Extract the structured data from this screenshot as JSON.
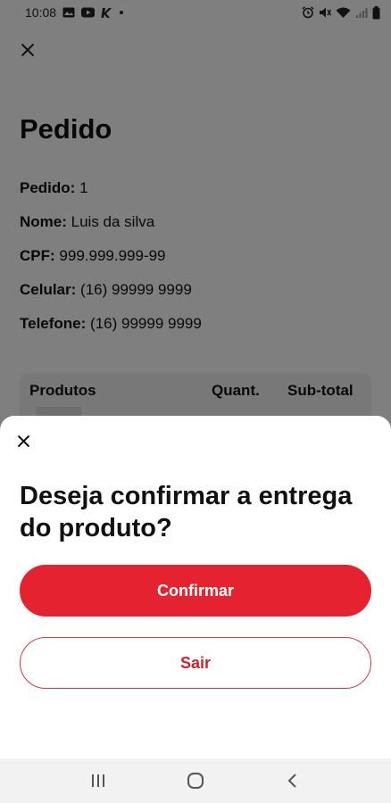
{
  "status_bar": {
    "time": "10:08"
  },
  "page": {
    "title": "Pedido",
    "fields": [
      {
        "label": "Pedido:",
        "value": "1"
      },
      {
        "label": "Nome:",
        "value": "Luis da silva"
      },
      {
        "label": "CPF:",
        "value": "999.999.999-99"
      },
      {
        "label": "Celular:",
        "value": "(16) 99999 9999"
      },
      {
        "label": "Telefone:",
        "value": "(16) 99999 9999"
      }
    ],
    "table_headers": {
      "produtos": "Produtos",
      "quant": "Quant.",
      "subtotal": "Sub-total"
    }
  },
  "sheet": {
    "question": "Deseja confirmar a entrega do produto?",
    "confirm_label": "Confirmar",
    "exit_label": "Sair"
  },
  "colors": {
    "primary": "#e52330",
    "scrim": "rgba(0,0,0,0.5)"
  }
}
